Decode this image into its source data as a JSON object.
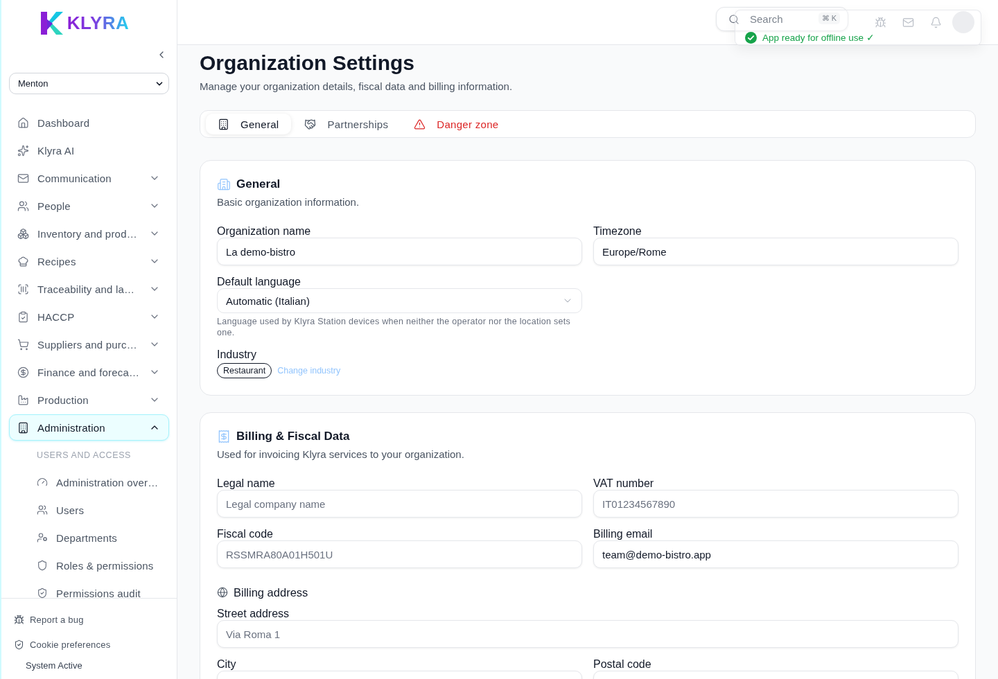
{
  "sidebar": {
    "logo": "KLYRA",
    "location": "Menton",
    "nav": [
      {
        "label": "Dashboard",
        "kind": "link",
        "selected": false
      },
      {
        "label": "Klyra AI",
        "kind": "link",
        "selected": false
      },
      {
        "label": "Communication",
        "kind": "group",
        "expanded": false,
        "selected": false
      },
      {
        "label": "People",
        "kind": "group",
        "expanded": false,
        "selected": false
      },
      {
        "label": "Inventory and prod…",
        "kind": "group",
        "expanded": false,
        "selected": false
      },
      {
        "label": "Recipes",
        "kind": "group",
        "expanded": false,
        "selected": false
      },
      {
        "label": "Traceability and la…",
        "kind": "group",
        "expanded": false,
        "selected": false
      },
      {
        "label": "HACCP",
        "kind": "group",
        "expanded": false,
        "selected": false
      },
      {
        "label": "Suppliers and purc…",
        "kind": "group",
        "expanded": false,
        "selected": false
      },
      {
        "label": "Finance and foreca…",
        "kind": "group",
        "expanded": false,
        "selected": false
      },
      {
        "label": "Production",
        "kind": "group",
        "expanded": false,
        "selected": false
      },
      {
        "label": "Administration",
        "kind": "group",
        "expanded": true,
        "selected": true,
        "section": "USERS AND ACCESS",
        "children": [
          {
            "label": "Administration over…",
            "selected": false
          },
          {
            "label": "Users",
            "selected": false
          },
          {
            "label": "Departments",
            "selected": false
          },
          {
            "label": "Roles & permissions",
            "selected": false
          },
          {
            "label": "Permissions audit",
            "selected": false
          }
        ]
      }
    ],
    "footer": [
      {
        "label": "Report a bug",
        "kind": "action"
      },
      {
        "label": "Cookie preferences",
        "kind": "action"
      },
      {
        "label": "System Active",
        "kind": "status"
      }
    ]
  },
  "topbar": {
    "search": {
      "placeholder": "Search",
      "shortcut": "⌘ K"
    },
    "toast": "App ready for offline use ✓"
  },
  "page": {
    "title": "Organization Settings",
    "subtitle": "Manage your organization details, fiscal data and billing information."
  },
  "tabs": [
    {
      "label": "General",
      "kind": "default",
      "selected": true
    },
    {
      "label": "Partnerships",
      "kind": "default",
      "selected": false
    },
    {
      "label": "Danger zone",
      "kind": "danger",
      "selected": false
    }
  ],
  "general": {
    "title": "General",
    "subtitle": "Basic organization information.",
    "fields": [
      {
        "label": "Organization name",
        "value": "La demo-bistro"
      },
      {
        "label": "Timezone",
        "value": "Europe/Rome"
      }
    ],
    "language": {
      "label": "Default language",
      "value": "Automatic (Italian)",
      "help": "Language used by Klyra Station devices when neither the operator nor the location sets one."
    },
    "industry": {
      "label": "Industry",
      "tag": "Restaurant",
      "link": "Change industry"
    }
  },
  "billing": {
    "title": "Billing & Fiscal Data",
    "subtitle": "Used for invoicing Klyra services to your organization.",
    "fields": [
      {
        "label": "Legal name",
        "placeholder": "Legal company name"
      },
      {
        "label": "VAT number",
        "placeholder": "IT01234567890"
      },
      {
        "label": "Fiscal code",
        "placeholder": "RSSMRA80A01H501U"
      },
      {
        "label": "Billing email",
        "value": "team@demo-bistro.app"
      }
    ],
    "address": {
      "title": "Billing address",
      "street": {
        "label": "Street address",
        "placeholder": "Via Roma 1"
      },
      "fields": [
        {
          "label": "City"
        },
        {
          "label": "Postal code"
        }
      ]
    }
  }
}
